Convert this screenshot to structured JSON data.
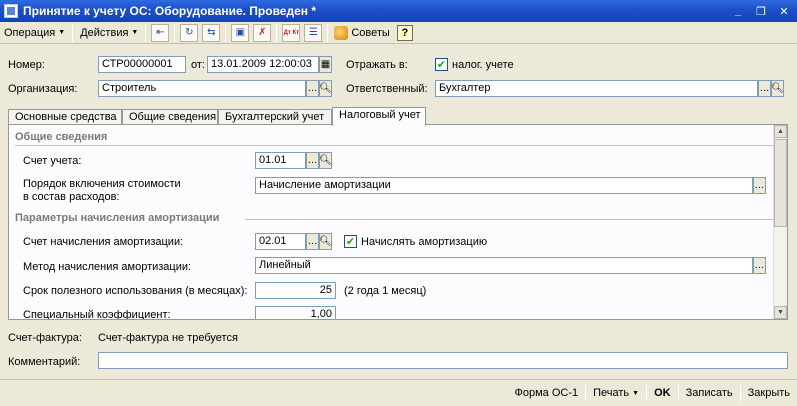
{
  "window": {
    "title": "Принятие к учету ОС: Оборудование. Проведен *",
    "minimize": "_",
    "maximize": "❐",
    "close": "✕"
  },
  "toolbar": {
    "operation_label": "Операция",
    "actions_label": "Действия",
    "advice_label": "Советы",
    "help_label": "?",
    "dropdown_arrow": "▼",
    "dtkt_label": "Дт Кт"
  },
  "header": {
    "number_label": "Номер:",
    "number_value": "СТР00000001",
    "date_label": "от:",
    "date_value": "13.01.2009 12:00:03",
    "reflect_label": "Отражать в:",
    "tax_accounting_label": "налог. учете",
    "tax_accounting_checked": true,
    "org_label": "Организация:",
    "org_value": "Строитель",
    "responsible_label": "Ответственный:",
    "responsible_value": "Бухгалтер"
  },
  "tabs": [
    {
      "label": "Основные средства",
      "active": false
    },
    {
      "label": "Общие сведения",
      "active": false
    },
    {
      "label": "Бухгалтерский учет",
      "active": false
    },
    {
      "label": "Налоговый учет",
      "active": true
    }
  ],
  "tax_tab": {
    "general_section": "Общие сведения",
    "account_label": "Счет учета:",
    "account_value": "01.01",
    "inclusion_label_1": "Порядок включения стоимости",
    "inclusion_label_2": "в состав расходов:",
    "inclusion_value": "Начисление амортизации",
    "params_section": "Параметры начисления амортизации",
    "depr_account_label": "Счет начисления амортизации:",
    "depr_account_value": "02.01",
    "charge_depr_label": "Начислять амортизацию",
    "charge_depr_checked": true,
    "method_label": "Метод начисления амортизации:",
    "method_value": "Линейный",
    "useful_life_label": "Срок полезного использования (в месяцах):",
    "useful_life_value": "25",
    "useful_life_note": "(2 года 1 месяц)",
    "coef_label": "Специальный коэффициент:",
    "coef_value": "1,00"
  },
  "footer_fields": {
    "invoice_label": "Счет-фактура:",
    "invoice_value": "Счет-фактура не требуется",
    "comment_label": "Комментарий:",
    "comment_value": ""
  },
  "statusbar": {
    "form_os1": "Форма ОС-1",
    "print": "Печать",
    "ok": "OK",
    "save": "Записать",
    "close": "Закрыть"
  }
}
